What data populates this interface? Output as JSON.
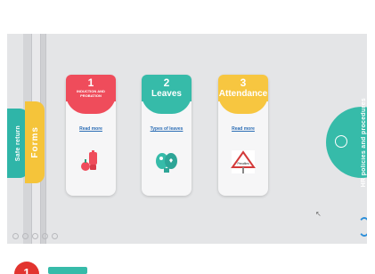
{
  "side_tabs": [
    {
      "label": "Safe return"
    },
    {
      "label": "Forms"
    }
  ],
  "cards": [
    {
      "number": "1",
      "title": "INDUCTION AND PROBATION",
      "link": "Read more",
      "icon": "smoothie-blender-icon",
      "color": "#ef4c5b"
    },
    {
      "number": "2",
      "title": "Leaves",
      "link": "Types of leaves",
      "icon": "brain-icon",
      "color": "#36bba9"
    },
    {
      "number": "3",
      "title": "Attendance",
      "link": "Read more",
      "icon": "warning-sign-icon",
      "color": "#f7c640",
      "sign_text": "Penalties"
    }
  ],
  "right_panel": {
    "label": "HR policies and procedures",
    "icon": "lightbulb-icon"
  },
  "bottom": {
    "badge_number": "1"
  }
}
